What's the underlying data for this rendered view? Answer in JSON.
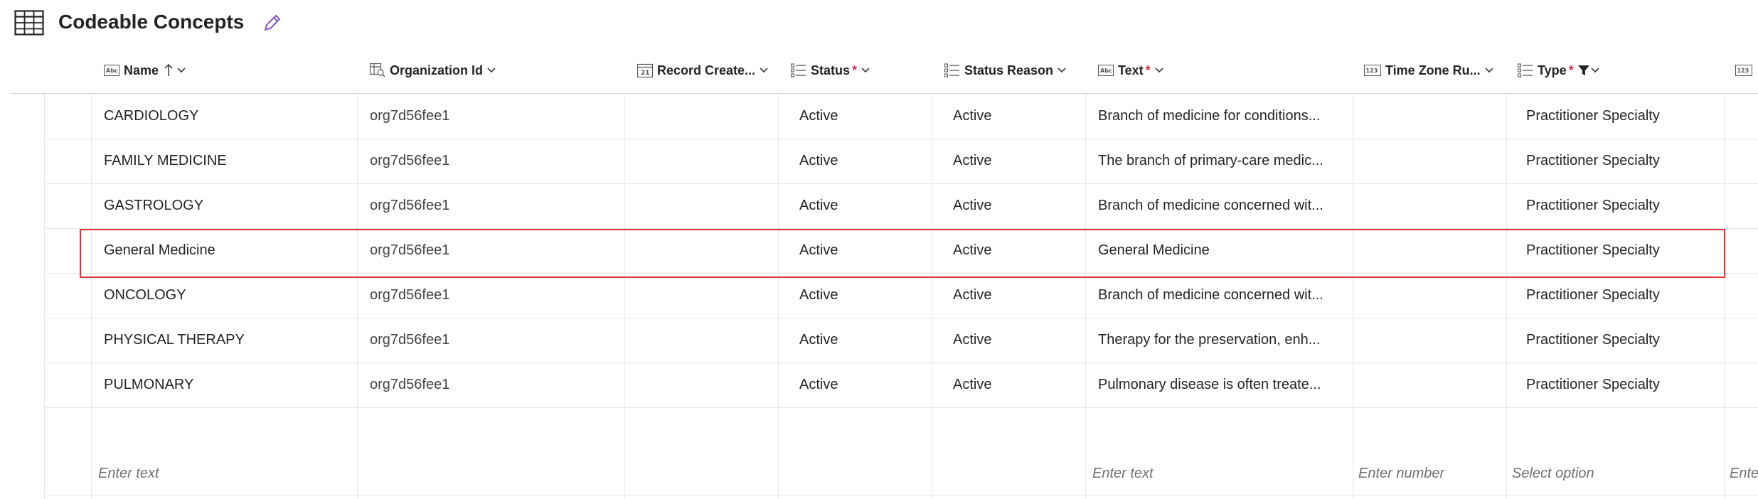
{
  "page": {
    "title": "Codeable Concepts"
  },
  "columns": [
    {
      "key": "name",
      "label": "Name",
      "icon": "text-field-icon",
      "required": false,
      "sorted": "ascending"
    },
    {
      "key": "organization_id",
      "label": "Organization Id",
      "icon": "lookup-field-icon",
      "required": false
    },
    {
      "key": "record_created",
      "label": "Record Create...",
      "icon": "calendar-field-icon",
      "required": false
    },
    {
      "key": "status",
      "label": "Status",
      "icon": "choice-field-icon",
      "required": true
    },
    {
      "key": "status_reason",
      "label": "Status Reason",
      "icon": "choice-field-icon",
      "required": false
    },
    {
      "key": "text",
      "label": "Text",
      "icon": "text-field-icon",
      "required": true
    },
    {
      "key": "time_zone",
      "label": "Time Zone Ru...",
      "icon": "number-field-icon",
      "required": false
    },
    {
      "key": "type",
      "label": "Type",
      "icon": "choice-field-icon",
      "required": true,
      "filtered": true
    },
    {
      "key": "next",
      "label": "",
      "icon": "number-field-icon",
      "required": false
    }
  ],
  "rows": [
    {
      "name": "CARDIOLOGY",
      "organization_id": "org7d56fee1",
      "record_created": "",
      "status": "Active",
      "status_reason": "Active",
      "text": "Branch of medicine for conditions...",
      "time_zone": "",
      "type": "Practitioner Specialty"
    },
    {
      "name": "FAMILY MEDICINE",
      "organization_id": "org7d56fee1",
      "record_created": "",
      "status": "Active",
      "status_reason": "Active",
      "text": "The branch of primary-care medic...",
      "time_zone": "",
      "type": "Practitioner Specialty"
    },
    {
      "name": "GASTROLOGY",
      "organization_id": "org7d56fee1",
      "record_created": "",
      "status": "Active",
      "status_reason": "Active",
      "text": "Branch of medicine concerned wit...",
      "time_zone": "",
      "type": "Practitioner Specialty"
    },
    {
      "name": "General Medicine",
      "organization_id": "org7d56fee1",
      "record_created": "",
      "status": "Active",
      "status_reason": "Active",
      "text": "General Medicine",
      "time_zone": "",
      "type": "Practitioner Specialty",
      "highlighted": true
    },
    {
      "name": "ONCOLOGY",
      "organization_id": "org7d56fee1",
      "record_created": "",
      "status": "Active",
      "status_reason": "Active",
      "text": "Branch of medicine concerned wit...",
      "time_zone": "",
      "type": "Practitioner Specialty"
    },
    {
      "name": "PHYSICAL THERAPY",
      "organization_id": "org7d56fee1",
      "record_created": "",
      "status": "Active",
      "status_reason": "Active",
      "text": "Therapy for the preservation, enh...",
      "time_zone": "",
      "type": "Practitioner Specialty"
    },
    {
      "name": "PULMONARY",
      "organization_id": "org7d56fee1",
      "record_created": "",
      "status": "Active",
      "status_reason": "Active",
      "text": "Pulmonary disease is often treate...",
      "time_zone": "",
      "type": "Practitioner Specialty"
    }
  ],
  "new_row": {
    "name_placeholder": "Enter text",
    "text_placeholder": "Enter text",
    "time_zone_placeholder": "Enter number",
    "type_placeholder": "Select option",
    "next_placeholder": "Ente"
  },
  "colors": {
    "accent": "#8a5cc7",
    "required": "#c4314b",
    "highlight": "#e0343b"
  }
}
